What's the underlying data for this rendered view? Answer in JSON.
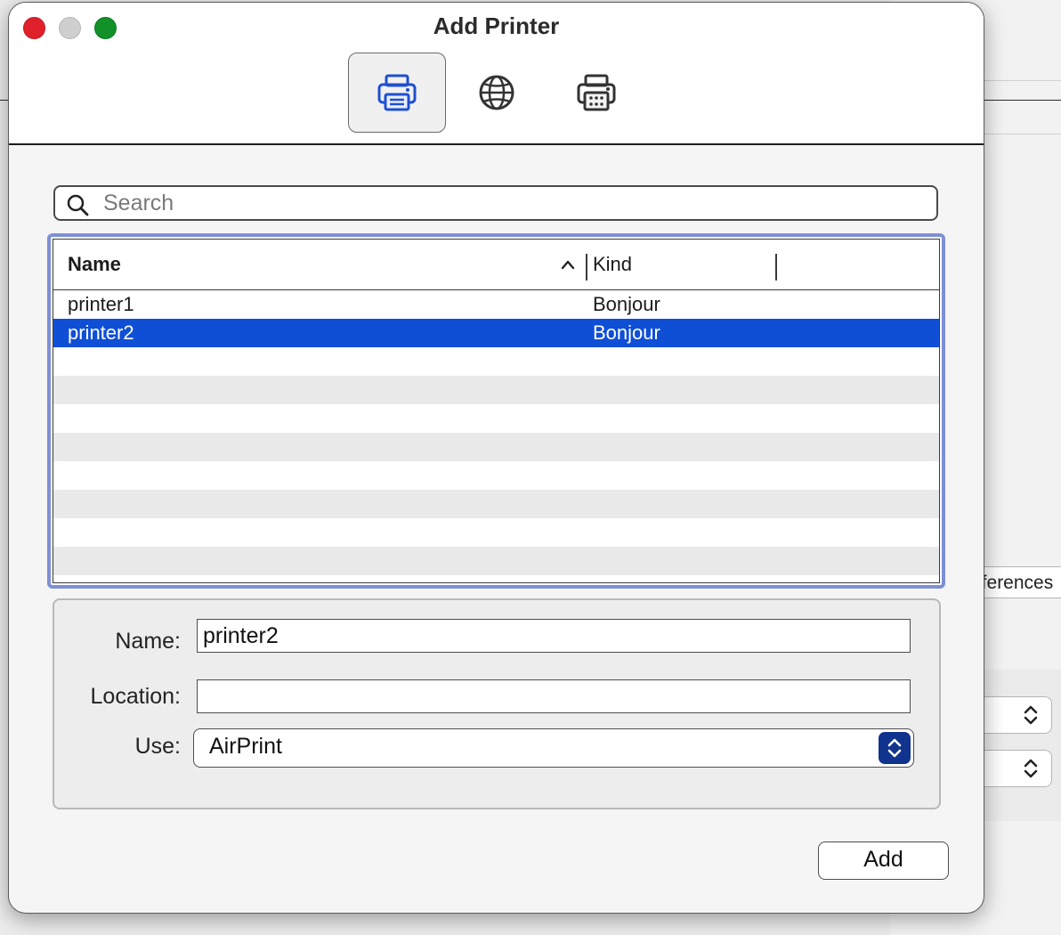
{
  "dialog": {
    "title": "Add Printer",
    "toolbar": [
      {
        "name": "default-printer-tab",
        "icon": "printer-icon",
        "selected": true
      },
      {
        "name": "ip-printer-tab",
        "icon": "globe-icon",
        "selected": false
      },
      {
        "name": "windows-printer-tab",
        "icon": "printer-grid-icon",
        "selected": false
      }
    ],
    "search": {
      "placeholder": "Search",
      "value": ""
    },
    "table": {
      "columns": [
        "Name",
        "Kind"
      ],
      "sort_column": "Name",
      "sort_direction": "ascending",
      "rows": [
        {
          "name": "printer1",
          "kind": "Bonjour",
          "selected": false
        },
        {
          "name": "printer2",
          "kind": "Bonjour",
          "selected": true
        }
      ]
    },
    "details": {
      "name_label": "Name:",
      "name_value": "printer2",
      "location_label": "Location:",
      "location_value": "",
      "use_label": "Use:",
      "use_value": "AirPrint"
    },
    "add_button": "Add"
  },
  "background": {
    "button_text": "eferences"
  },
  "colors": {
    "selection": "#0f4fd6",
    "focus_ring": "#7d8fd6",
    "accent_icon": "#1e4fd0",
    "close": "#e0212b",
    "maximize": "#119128"
  }
}
